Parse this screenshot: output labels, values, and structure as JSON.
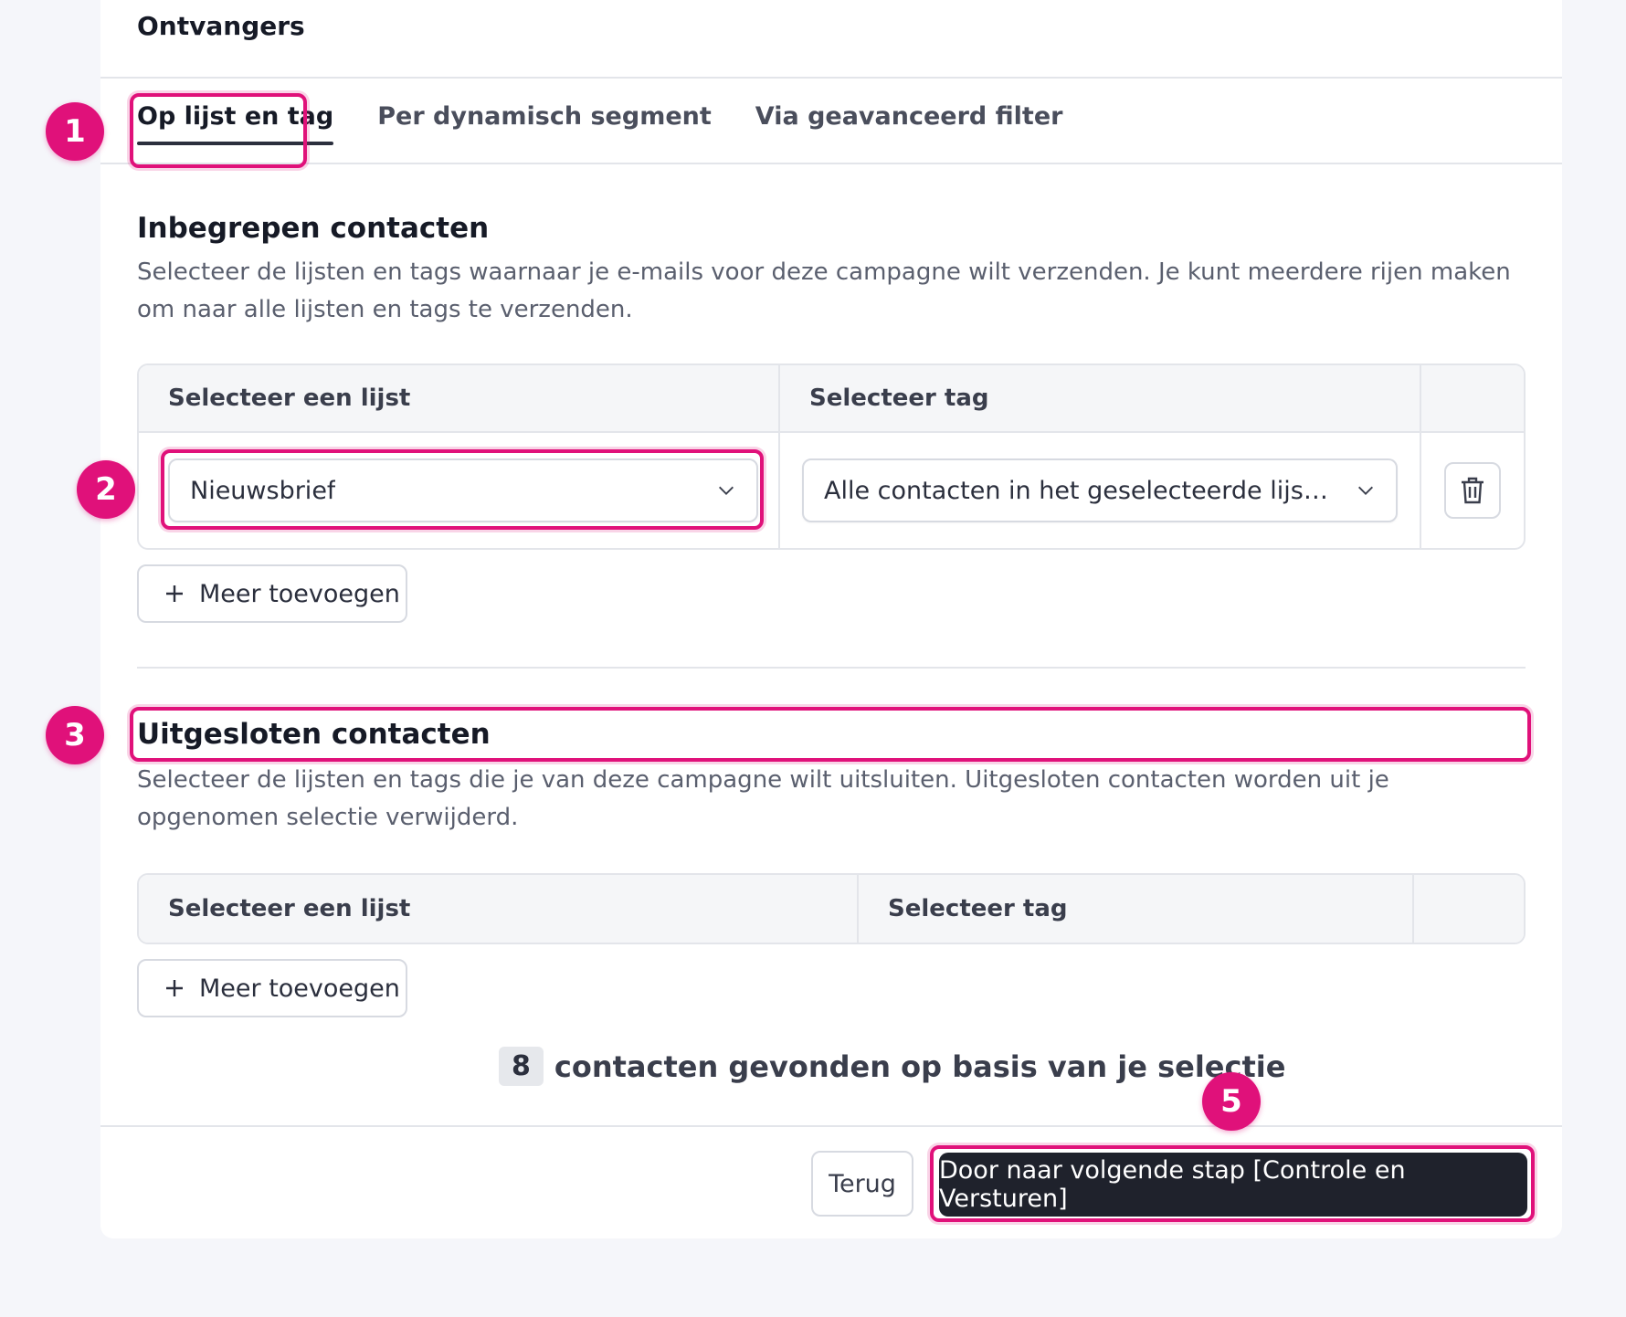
{
  "card": {
    "title": "Ontvangers"
  },
  "tabs": [
    {
      "label": "Op lijst en tag",
      "active": true
    },
    {
      "label": "Per dynamisch segment",
      "active": false
    },
    {
      "label": "Via geavanceerd filter",
      "active": false
    }
  ],
  "included": {
    "title": "Inbegrepen contacten",
    "description": "Selecteer de lijsten en tags waarnaar je e-mails voor deze campagne wilt verzenden. Je kunt meerdere rijen maken om naar alle lijsten en tags te verzenden.",
    "table": {
      "headers": [
        "Selecteer een lijst",
        "Selecteer tag",
        ""
      ],
      "rows": [
        {
          "list": "Nieuwsbrief",
          "tag": "Alle contacten in het geselecteerde lijstseg...",
          "delete_icon": "trash-icon"
        }
      ]
    },
    "add_label": "Meer toevoegen"
  },
  "excluded": {
    "title": "Uitgesloten contacten",
    "description": "Selecteer de lijsten en tags die je van deze campagne wilt uitsluiten. Uitgesloten contacten worden uit je opgenomen selectie verwijderd.",
    "table": {
      "headers": [
        "Selecteer een lijst",
        "Selecteer tag",
        ""
      ]
    },
    "add_label": "Meer toevoegen"
  },
  "result": {
    "count": "8",
    "text": "contacten gevonden op basis van je selectie"
  },
  "footer": {
    "back_label": "Terug",
    "next_label": "Door naar volgende stap [Controle en Versturen]"
  },
  "annotations": {
    "m1": "1",
    "m2": "2",
    "m3": "3",
    "m5": "5"
  },
  "colors": {
    "highlight": "#e0117a",
    "primary_button": "#1f222c"
  }
}
